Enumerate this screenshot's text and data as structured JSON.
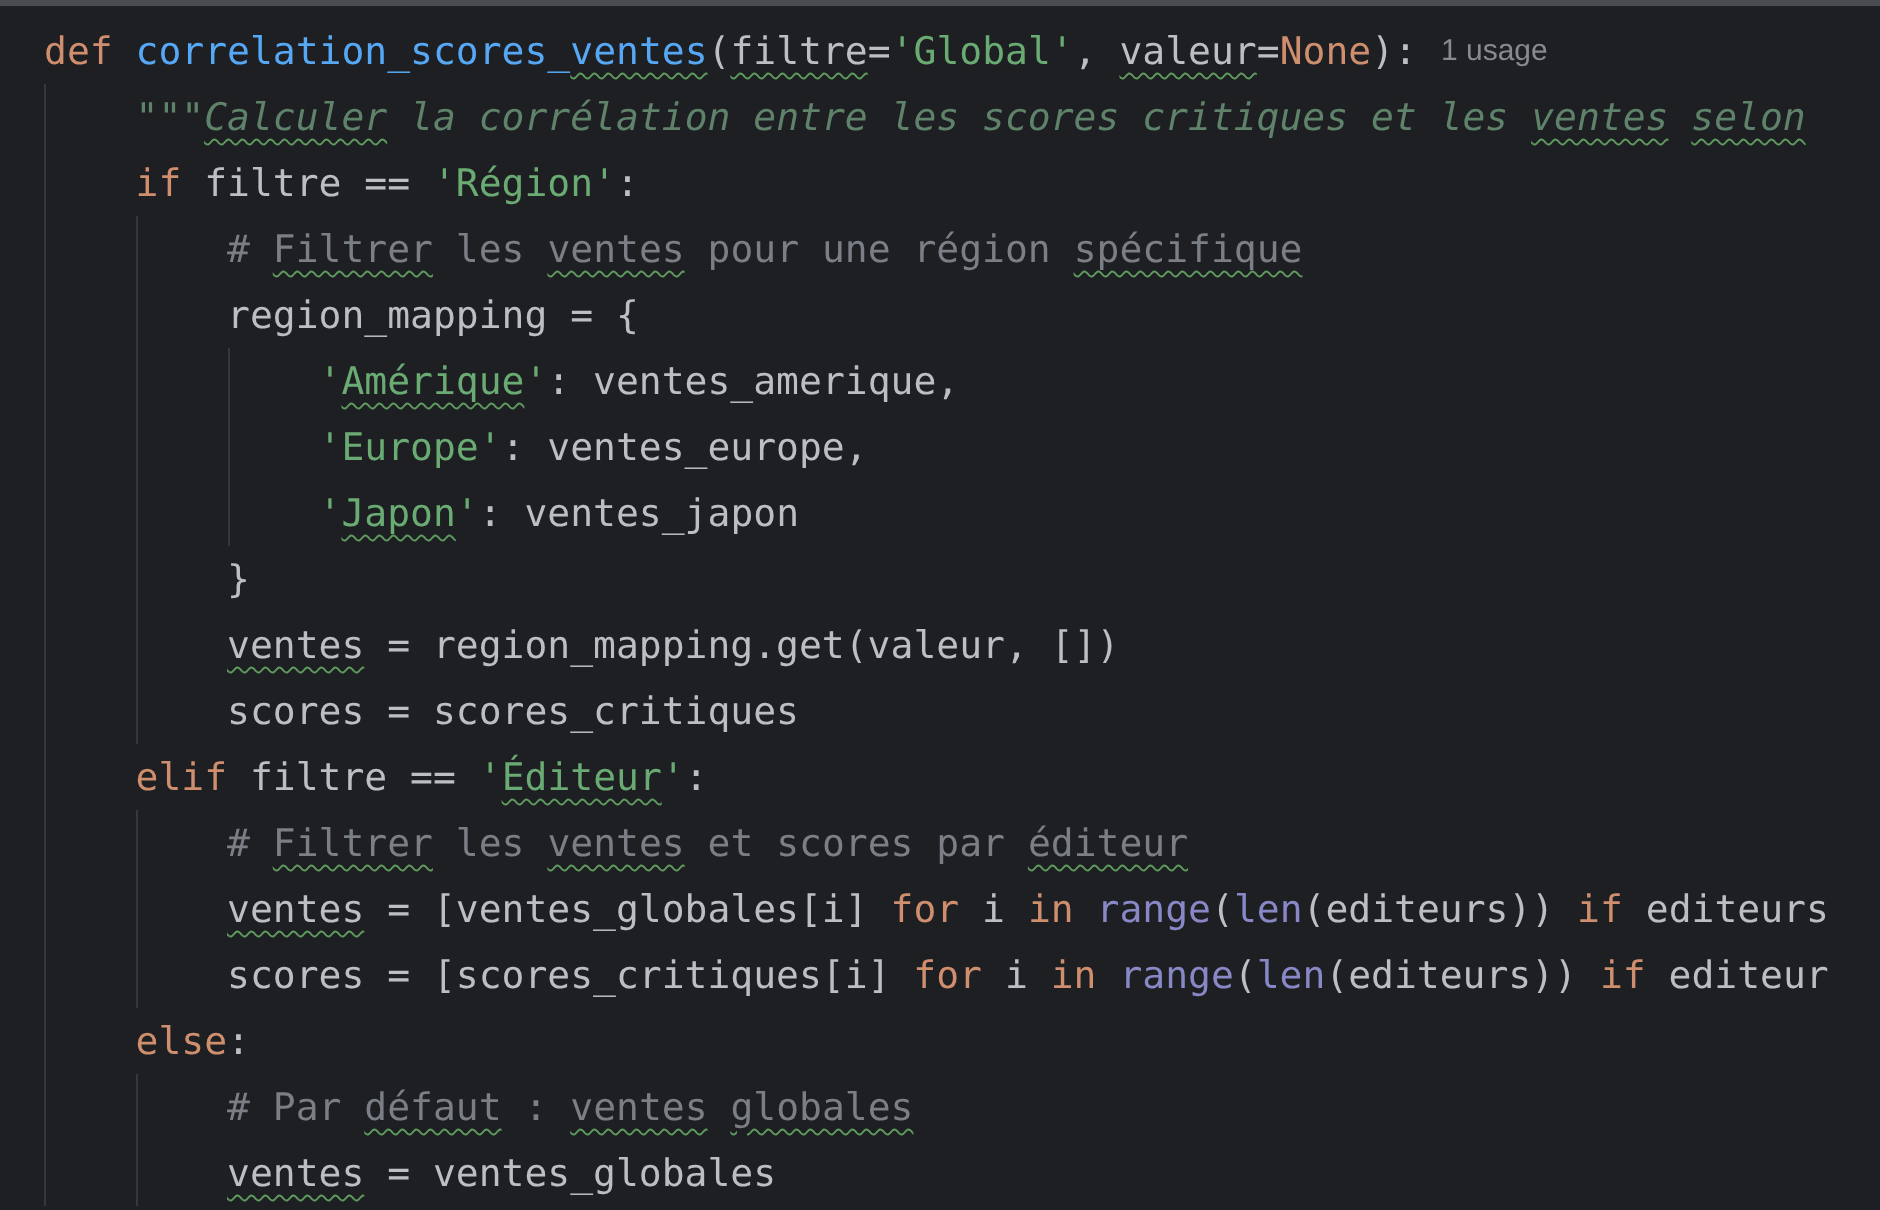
{
  "editor": {
    "lines": [
      {
        "tokens": [
          {
            "text": "def",
            "kind": "keyword",
            "typo": false
          },
          {
            "text": " correlation_scores_",
            "kind": "function",
            "typo": false
          },
          {
            "text": "ventes",
            "kind": "function",
            "typo": true
          },
          {
            "text": "(",
            "kind": "plain",
            "typo": false
          },
          {
            "text": "filtre",
            "kind": "plain",
            "typo": true
          },
          {
            "text": "=",
            "kind": "plain",
            "typo": false
          },
          {
            "text": "'Global'",
            "kind": "string",
            "typo": false
          },
          {
            "text": ", ",
            "kind": "plain",
            "typo": false
          },
          {
            "text": "valeur",
            "kind": "plain",
            "typo": true
          },
          {
            "text": "=",
            "kind": "plain",
            "typo": false
          },
          {
            "text": "None",
            "kind": "keyword",
            "typo": false
          },
          {
            "text": "):",
            "kind": "plain",
            "typo": false
          },
          {
            "text": "1 usage",
            "kind": "hint",
            "typo": false
          }
        ],
        "children": [
          {
            "tokens": [
              {
                "text": "\"\"\"",
                "kind": "docstring",
                "typo": false
              },
              {
                "text": "Calculer",
                "kind": "docstring",
                "typo": true
              },
              {
                "text": " la corrélation entre les scores critiques et les ",
                "kind": "docstring",
                "typo": false
              },
              {
                "text": "ventes",
                "kind": "docstring",
                "typo": true
              },
              {
                "text": " selon",
                "kind": "docstring",
                "typo": true
              }
            ]
          },
          {
            "tokens": [
              {
                "text": "if",
                "kind": "keyword",
                "typo": false
              },
              {
                "text": " filtre == ",
                "kind": "plain",
                "typo": false
              },
              {
                "text": "'Région'",
                "kind": "string",
                "typo": false
              },
              {
                "text": ":",
                "kind": "plain",
                "typo": false
              }
            ],
            "children": [
              {
                "tokens": [
                  {
                    "text": "# ",
                    "kind": "comment",
                    "typo": false
                  },
                  {
                    "text": "Filtrer",
                    "kind": "comment",
                    "typo": true
                  },
                  {
                    "text": " les ",
                    "kind": "comment",
                    "typo": false
                  },
                  {
                    "text": "ventes",
                    "kind": "comment",
                    "typo": true
                  },
                  {
                    "text": " pour une région ",
                    "kind": "comment",
                    "typo": false
                  },
                  {
                    "text": "spécifique",
                    "kind": "comment",
                    "typo": true
                  }
                ]
              },
              {
                "tokens": [
                  {
                    "text": "region_mapping = {",
                    "kind": "plain",
                    "typo": false
                  }
                ],
                "children": [
                  {
                    "tokens": [
                      {
                        "text": "'",
                        "kind": "string",
                        "typo": false
                      },
                      {
                        "text": "Amérique",
                        "kind": "string",
                        "typo": true
                      },
                      {
                        "text": "'",
                        "kind": "string",
                        "typo": false
                      },
                      {
                        "text": ": ventes_amerique,",
                        "kind": "plain",
                        "typo": false
                      }
                    ]
                  },
                  {
                    "tokens": [
                      {
                        "text": "'Europe'",
                        "kind": "string",
                        "typo": false
                      },
                      {
                        "text": ": ventes_europe,",
                        "kind": "plain",
                        "typo": false
                      }
                    ]
                  },
                  {
                    "tokens": [
                      {
                        "text": "'",
                        "kind": "string",
                        "typo": false
                      },
                      {
                        "text": "Japon",
                        "kind": "string",
                        "typo": true
                      },
                      {
                        "text": "'",
                        "kind": "string",
                        "typo": false
                      },
                      {
                        "text": ": ventes_japon",
                        "kind": "plain",
                        "typo": false
                      }
                    ]
                  }
                ]
              },
              {
                "tokens": [
                  {
                    "text": "}",
                    "kind": "plain",
                    "typo": false
                  }
                ]
              },
              {
                "tokens": [
                  {
                    "text": "ventes",
                    "kind": "plain",
                    "typo": true
                  },
                  {
                    "text": " = region_mapping.get(valeur, [])",
                    "kind": "plain",
                    "typo": false
                  }
                ]
              },
              {
                "tokens": [
                  {
                    "text": "scores = scores_critiques",
                    "kind": "plain",
                    "typo": false
                  }
                ]
              }
            ]
          },
          {
            "tokens": [
              {
                "text": "elif",
                "kind": "keyword",
                "typo": false
              },
              {
                "text": " filtre == ",
                "kind": "plain",
                "typo": false
              },
              {
                "text": "'",
                "kind": "string",
                "typo": false
              },
              {
                "text": "Éditeur",
                "kind": "string",
                "typo": true
              },
              {
                "text": "'",
                "kind": "string",
                "typo": false
              },
              {
                "text": ":",
                "kind": "plain",
                "typo": false
              }
            ],
            "children": [
              {
                "tokens": [
                  {
                    "text": "# ",
                    "kind": "comment",
                    "typo": false
                  },
                  {
                    "text": "Filtrer",
                    "kind": "comment",
                    "typo": true
                  },
                  {
                    "text": " les ",
                    "kind": "comment",
                    "typo": false
                  },
                  {
                    "text": "ventes",
                    "kind": "comment",
                    "typo": true
                  },
                  {
                    "text": " et scores par ",
                    "kind": "comment",
                    "typo": false
                  },
                  {
                    "text": "éditeur",
                    "kind": "comment",
                    "typo": true
                  }
                ]
              },
              {
                "tokens": [
                  {
                    "text": "ventes",
                    "kind": "plain",
                    "typo": true
                  },
                  {
                    "text": " = [ventes_globales[i] ",
                    "kind": "plain",
                    "typo": false
                  },
                  {
                    "text": "for",
                    "kind": "keyword",
                    "typo": false
                  },
                  {
                    "text": " i ",
                    "kind": "plain",
                    "typo": false
                  },
                  {
                    "text": "in",
                    "kind": "keyword",
                    "typo": false
                  },
                  {
                    "text": " range",
                    "kind": "builtin",
                    "typo": false
                  },
                  {
                    "text": "(",
                    "kind": "plain",
                    "typo": false
                  },
                  {
                    "text": "len",
                    "kind": "builtin",
                    "typo": false
                  },
                  {
                    "text": "(editeurs)) ",
                    "kind": "plain",
                    "typo": false
                  },
                  {
                    "text": "if",
                    "kind": "keyword",
                    "typo": false
                  },
                  {
                    "text": " editeurs",
                    "kind": "plain",
                    "typo": false
                  }
                ]
              },
              {
                "tokens": [
                  {
                    "text": "scores = [scores_critiques[i] ",
                    "kind": "plain",
                    "typo": false
                  },
                  {
                    "text": "for",
                    "kind": "keyword",
                    "typo": false
                  },
                  {
                    "text": " i ",
                    "kind": "plain",
                    "typo": false
                  },
                  {
                    "text": "in",
                    "kind": "keyword",
                    "typo": false
                  },
                  {
                    "text": " range",
                    "kind": "builtin",
                    "typo": false
                  },
                  {
                    "text": "(",
                    "kind": "plain",
                    "typo": false
                  },
                  {
                    "text": "len",
                    "kind": "builtin",
                    "typo": false
                  },
                  {
                    "text": "(editeurs)) ",
                    "kind": "plain",
                    "typo": false
                  },
                  {
                    "text": "if",
                    "kind": "keyword",
                    "typo": false
                  },
                  {
                    "text": " editeur",
                    "kind": "plain",
                    "typo": false
                  }
                ]
              }
            ]
          },
          {
            "tokens": [
              {
                "text": "else",
                "kind": "keyword",
                "typo": false
              },
              {
                "text": ":",
                "kind": "plain",
                "typo": false
              }
            ],
            "children": [
              {
                "tokens": [
                  {
                    "text": "# Par ",
                    "kind": "comment",
                    "typo": false
                  },
                  {
                    "text": "défaut",
                    "kind": "comment",
                    "typo": true
                  },
                  {
                    "text": " : ",
                    "kind": "comment",
                    "typo": false
                  },
                  {
                    "text": "ventes",
                    "kind": "comment",
                    "typo": true
                  },
                  {
                    "text": " globales",
                    "kind": "comment",
                    "typo": true
                  }
                ]
              },
              {
                "tokens": [
                  {
                    "text": "ventes",
                    "kind": "plain",
                    "typo": true
                  },
                  {
                    "text": " = ventes_globales",
                    "kind": "plain",
                    "typo": false
                  }
                ]
              }
            ]
          }
        ]
      }
    ]
  }
}
